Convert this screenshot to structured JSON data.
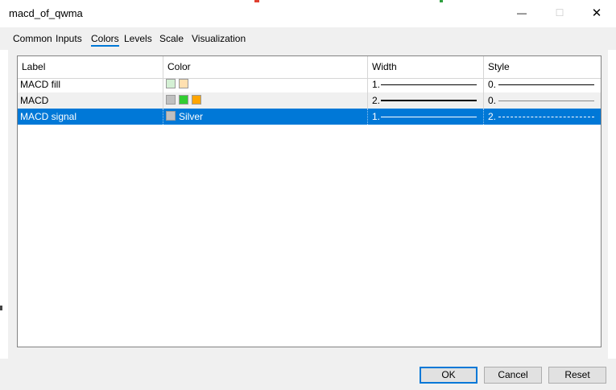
{
  "window": {
    "title": "macd_of_qwma",
    "minimize_glyph": "—",
    "maximize_glyph": "☐",
    "close_glyph": "✕"
  },
  "tabs": [
    {
      "label": "Common"
    },
    {
      "label": "Inputs"
    },
    {
      "label": "Colors"
    },
    {
      "label": "Levels"
    },
    {
      "label": "Scale"
    },
    {
      "label": "Visualization"
    }
  ],
  "active_tab": "Colors",
  "grid": {
    "headers": {
      "label": "Label",
      "color": "Color",
      "width": "Width",
      "style": "Style"
    },
    "rows": [
      {
        "label": "MACD fill",
        "swatches": [
          "#d4f0d4",
          "#ffe0b0"
        ],
        "color_name": "",
        "width": "1.",
        "style": "0."
      },
      {
        "label": "MACD",
        "swatches": [
          "#c0c0c0",
          "#32cd32",
          "#ffa500"
        ],
        "color_name": "",
        "width": "2.",
        "style": "0."
      },
      {
        "label": "MACD signal",
        "swatches": [
          "#c0c0c0"
        ],
        "color_name": "Silver",
        "width": "1.",
        "style": "2."
      }
    ]
  },
  "buttons": {
    "ok": "OK",
    "cancel": "Cancel",
    "reset": "Reset"
  },
  "colors": {
    "accent": "#0078d7",
    "selection": "#0078d7",
    "panel": "#f0f0f0"
  }
}
